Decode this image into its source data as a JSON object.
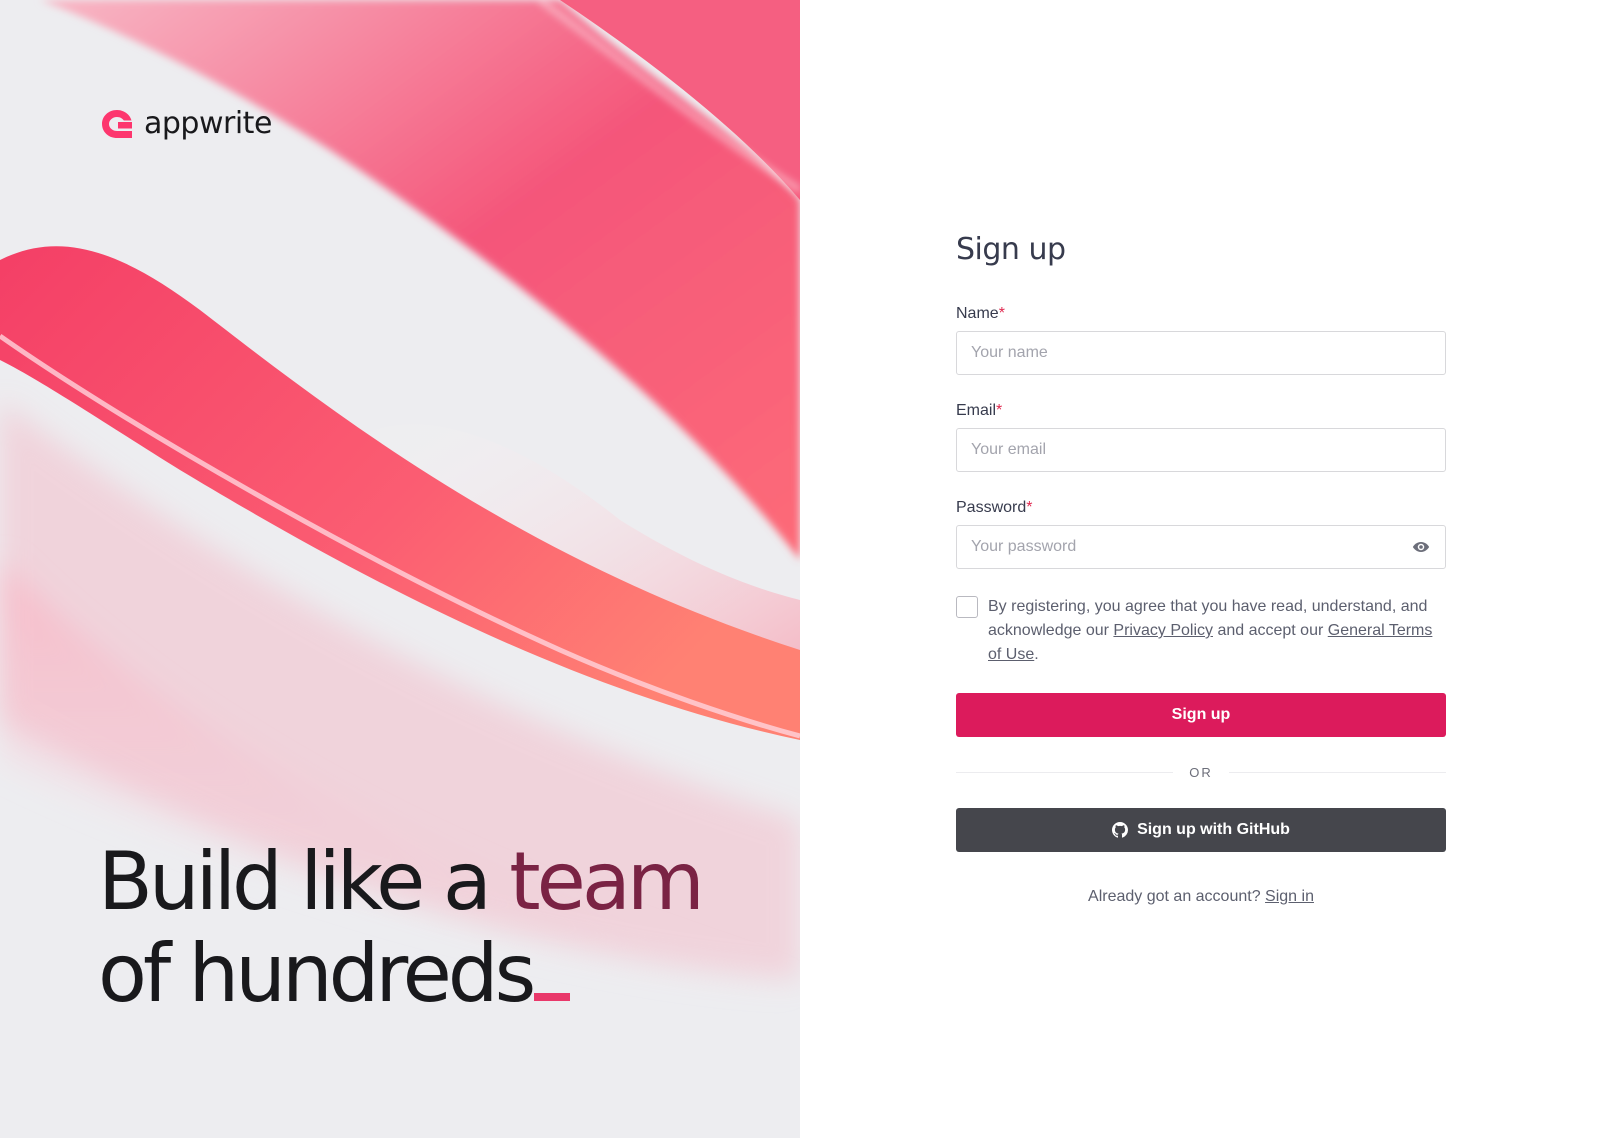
{
  "brand": {
    "name": "appwrite",
    "accent_color": "#dc1b5c",
    "logo_icon": "appwrite-logo-icon"
  },
  "hero": {
    "tagline_part1": "Build like a ",
    "tagline_accent": "team",
    "tagline_part2": "of hundreds",
    "tagline_cursor": "_"
  },
  "form": {
    "title": "Sign up",
    "name_label": "Name",
    "name_placeholder": "Your name",
    "email_label": "Email",
    "email_placeholder": "Your email",
    "password_label": "Password",
    "password_placeholder": "Your password",
    "required_marker": "*",
    "password_toggle_icon": "eye-icon",
    "terms_prefix": "By registering, you agree that you have read, understand, and acknowledge our ",
    "privacy_link": "Privacy Policy",
    "terms_middle": " and accept our ",
    "terms_link": "General Terms of Use",
    "terms_suffix": ".",
    "signup_button": "Sign up",
    "divider_text": "OR",
    "github_button": "Sign up with GitHub",
    "github_icon": "github-icon",
    "signin_prompt": "Already got an account? ",
    "signin_link": "Sign in"
  },
  "colors": {
    "primary_button": "#dc1b5c",
    "github_button": "#45464c",
    "required": "#e0284f",
    "text": "#373b4d"
  }
}
